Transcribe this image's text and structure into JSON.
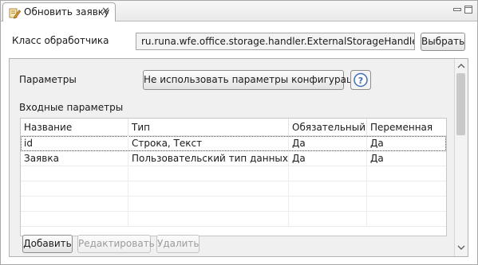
{
  "tab": {
    "title": "Обновить заявку",
    "icon": "form-edit-icon"
  },
  "handler": {
    "label": "Класс обработчика",
    "value": "ru.runa.wfe.office.storage.handler.ExternalStorageHandler",
    "choose_label": "Выбрать"
  },
  "params": {
    "label": "Параметры",
    "no_config_label": "Не использовать параметры конфигурации",
    "help_icon": "help-icon"
  },
  "input_params": {
    "label": "Входные параметры",
    "columns": [
      "Название",
      "Тип",
      "Обязательный",
      "Переменная"
    ],
    "rows": [
      [
        "id",
        "Строка, Текст",
        "Да",
        "Да"
      ],
      [
        "Заявка",
        "Пользовательский тип данных",
        "Да",
        "Да"
      ]
    ]
  },
  "actions": {
    "add": "Добавить",
    "edit": "Редактировать",
    "delete": "Удалить"
  },
  "colors": {
    "panel_bg": "#f0f0f0",
    "border": "#a8a8a8",
    "selection_outline": "#555555"
  }
}
